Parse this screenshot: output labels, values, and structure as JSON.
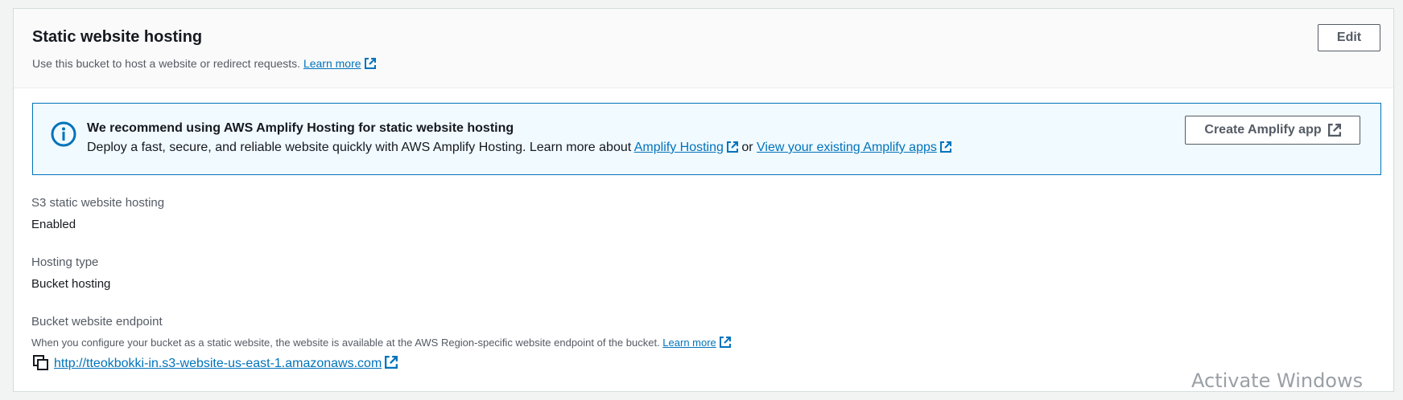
{
  "panel": {
    "title": "Static website hosting",
    "description": "Use this bucket to host a website or redirect requests.",
    "learn_more": "Learn more",
    "edit_label": "Edit"
  },
  "alert": {
    "title": "We recommend using AWS Amplify Hosting for static website hosting",
    "text_prefix": "Deploy a fast, secure, and reliable website quickly with AWS Amplify Hosting. Learn more about",
    "amplify_link": "Amplify Hosting",
    "or_text": "or",
    "existing_link": "View your existing Amplify apps",
    "button_label": "Create Amplify app",
    "icon": "info-icon"
  },
  "fields": {
    "s3_label": "S3 static website hosting",
    "s3_value": "Enabled",
    "type_label": "Hosting type",
    "type_value": "Bucket hosting",
    "endpoint_label": "Bucket website endpoint",
    "endpoint_desc": "When you configure your bucket as a static website, the website is available at the AWS Region-specific website endpoint of the bucket.",
    "endpoint_learn_more": "Learn more",
    "endpoint_url": "http://tteokbokki-in.s3-website-us-east-1.amazonaws.com"
  },
  "watermark": "Activate Windows",
  "colors": {
    "link": "#0073bb",
    "alert_bg": "#f1faff",
    "alert_border": "#0073bb"
  }
}
